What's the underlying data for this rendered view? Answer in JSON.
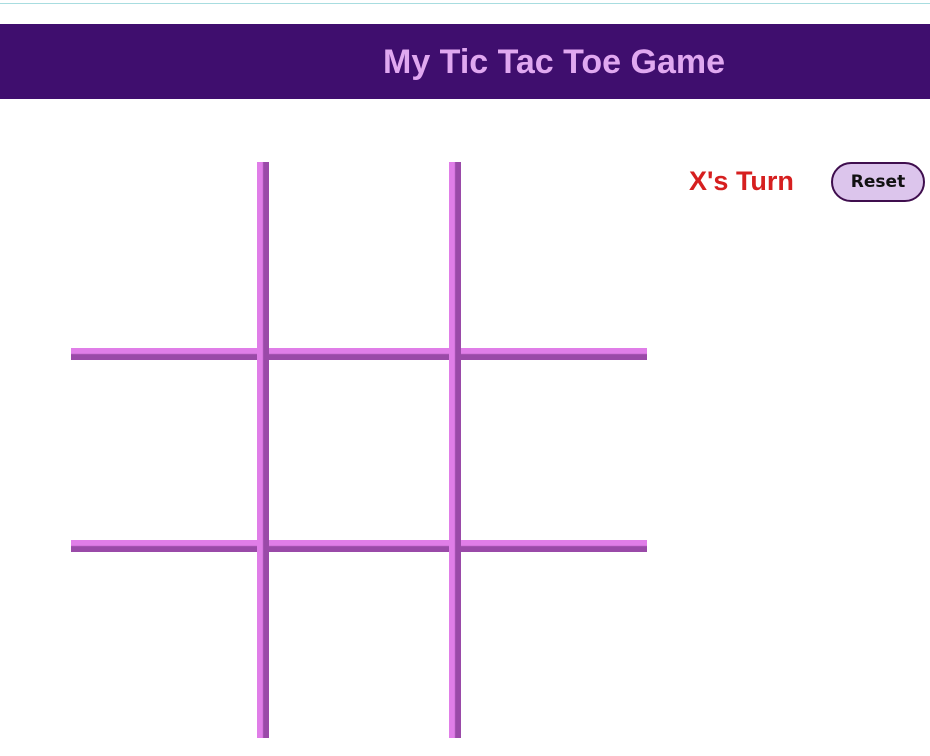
{
  "header": {
    "title": "My Tic Tac Toe Game"
  },
  "board": {
    "cells": [
      "",
      "",
      "",
      "",
      "",
      "",
      "",
      "",
      ""
    ]
  },
  "status": {
    "turn_text": "X's Turn"
  },
  "controls": {
    "reset_label": "Reset"
  },
  "colors": {
    "header_background": "#3f0e6e",
    "title_text": "#e0a8f0",
    "grid_light": "#e07ee8",
    "grid_dark": "#9a4aa8",
    "turn_text": "#d61f1f",
    "reset_background": "#dcc5ec"
  }
}
